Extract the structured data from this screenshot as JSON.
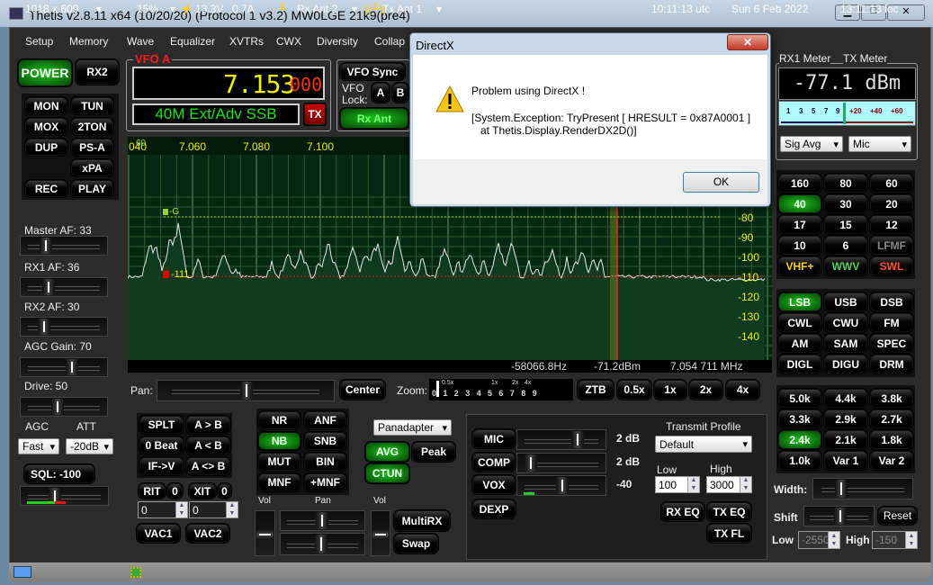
{
  "window": {
    "title": "Thetis v2.8.11 x64 (10/20/20) (Protocol 1 v3.2) MW0LGE 21k9(pre4)",
    "minimize": "▁",
    "maximize": "□",
    "close": "✕"
  },
  "menu": [
    "Setup",
    "Memory",
    "Wave",
    "Equalizer",
    "XVTRs",
    "CWX",
    "Diversity",
    "Collap"
  ],
  "left": {
    "power": "POWER",
    "rx2": "RX2",
    "mon": "MON",
    "tun": "TUN",
    "mox": "MOX",
    "twoton": "2TON",
    "dup": "DUP",
    "psa": "PS-A",
    "xpa": "xPA",
    "rec": "REC",
    "play": "PLAY",
    "master_af": "Master AF:  33",
    "rx1_af": "RX1 AF:  36",
    "rx2_af": "RX2 AF:  30",
    "agc_gain": "AGC Gain:  70",
    "drive": "Drive:  50",
    "agc_label": "AGC",
    "att_label": "ATT",
    "agc_value": "Fast",
    "att_value": "-20dB",
    "sql": "SQL: -100"
  },
  "levels": {
    "master_af": 33,
    "rx1_af": 36,
    "rx2_af": 30,
    "agc_gain": 70,
    "drive": 50
  },
  "vfo": {
    "label": "VFO A",
    "freq_main": "7.153",
    "freq_sub": "000",
    "band_mode": "40M Ext/Adv SSB",
    "tx": "TX",
    "sync": "VFO Sync",
    "lock": "VFO Lock:",
    "a": "A",
    "b": "B",
    "rx_ant": "Rx Ant"
  },
  "panadapter": {
    "freq_labels": [
      "040",
      "7.060",
      "7.080",
      "7.100"
    ],
    "marker_60": "60",
    "db_labels": [
      "-80",
      "-90",
      "-100",
      "-110",
      "-120",
      "-130",
      "-140"
    ],
    "agc_marker": "-G",
    "noise_marker": "-111",
    "cursor_offset": "-58066.8Hz",
    "cursor_dbm": "-71.2dBm",
    "cursor_freq": "7.054 711 MHz"
  },
  "pan": {
    "label": "Pan:",
    "center": "Center",
    "zoom_label": "Zoom:",
    "zoom_top": [
      "0.5x",
      "1x",
      "2x",
      "4x"
    ],
    "zoom_ticks": [
      "0",
      "1",
      "2",
      "3",
      "4",
      "5",
      "6",
      "7",
      "8",
      "9"
    ],
    "ztb": "ZTB",
    "z05": "0.5x",
    "z1": "1x",
    "z2": "2x",
    "z4": "4x"
  },
  "vfo_ops": {
    "splt": "SPLT",
    "a_b": "A > B",
    "zero_beat": "0 Beat",
    "b_a": "A < B",
    "if_v": "IF->V",
    "swap_ab": "A <> B",
    "rit": "RIT",
    "rit_val": "0",
    "xit": "XIT",
    "xit_val": "0",
    "rit_input": "0",
    "xit_input": "0",
    "vac1": "VAC1",
    "vac2": "VAC2"
  },
  "dsp": {
    "nr": "NR",
    "anf": "ANF",
    "nb": "NB",
    "snb": "SNB",
    "mut": "MUT",
    "bin": "BIN",
    "mnf": "MNF",
    "pmnf": "+MNF",
    "display_mode": "Panadapter",
    "avg": "AVG",
    "peak": "Peak",
    "ctun": "CTUN",
    "vol1": "Vol",
    "pan": "Pan",
    "vol2": "Vol",
    "multirx": "MultiRX",
    "swap": "Swap"
  },
  "tx": {
    "mic": "MIC",
    "mic_val": "2 dB",
    "comp": "COMP",
    "comp_val": "2 dB",
    "vox": "VOX",
    "vox_val": "-40",
    "dexp": "DEXP",
    "profile_label": "Transmit Profile",
    "profile": "Default",
    "low_label": "Low",
    "high_label": "High",
    "low": "100",
    "high": "3000",
    "rx_eq": "RX EQ",
    "tx_eq": "TX EQ",
    "tx_fl": "TX FL"
  },
  "meter": {
    "rx1_label": "RX1 Meter",
    "tx_label": "TX Meter",
    "reading": "-77.1 dBm",
    "scale": [
      "1",
      "3",
      "5",
      "7",
      "9",
      "+20",
      "+40",
      "+60"
    ],
    "rx_mode": "Sig Avg",
    "tx_mode": "Mic"
  },
  "bands": [
    [
      "160",
      "80",
      "60"
    ],
    [
      "40",
      "30",
      "20"
    ],
    [
      "17",
      "15",
      "12"
    ],
    [
      "10",
      "6",
      "LFMF"
    ],
    [
      "VHF+",
      "WWV",
      "SWL"
    ]
  ],
  "active_band": "40",
  "modes": [
    [
      "LSB",
      "USB",
      "DSB"
    ],
    [
      "CWL",
      "CWU",
      "FM"
    ],
    [
      "AM",
      "SAM",
      "SPEC"
    ],
    [
      "DIGL",
      "DIGU",
      "DRM"
    ]
  ],
  "active_mode": "LSB",
  "filters": [
    [
      "5.0k",
      "4.4k",
      "3.8k"
    ],
    [
      "3.3k",
      "2.9k",
      "2.7k"
    ],
    [
      "2.4k",
      "2.1k",
      "1.8k"
    ],
    [
      "1.0k",
      "Var 1",
      "Var 2"
    ]
  ],
  "active_filter": "2.4k",
  "filter_ctrl": {
    "width": "Width:",
    "shift": "Shift",
    "reset": "Reset",
    "low_label": "Low",
    "low": "-2550",
    "high_label": "High",
    "high": "-150"
  },
  "status": {
    "resolution": "1018 x 609",
    "cpu": "15%",
    "voltage": "13.3V",
    "current": "0.7A",
    "rx_ant": "Rx Ant 2",
    "tx_ant": "Tx Ant 1",
    "utc": "10:11:13 utc",
    "date": "Sun 6 Feb 2022",
    "local": "13:11:13 loc"
  },
  "dialog": {
    "title": "DirectX",
    "message": "Problem using DirectX !",
    "detail1": "[System.Exception: TryPresent [ HRESULT = 0x87A0001 ]",
    "detail2": "   at Thetis.Display.RenderDX2D()]",
    "ok": "OK",
    "close": "✕"
  },
  "colors": {
    "active_green": "#0b8a0b",
    "vfo_freq": "#f0f000",
    "vfo_sub": "#ff3300",
    "band_mode_text": "#19e619",
    "vhf": "#ffd400",
    "wwv": "#55d555",
    "swl": "#ff5533",
    "lfmf": "#8a8a8a",
    "spectrum_fill": "#0e3a1e",
    "cursor_red": "#ff2020"
  }
}
